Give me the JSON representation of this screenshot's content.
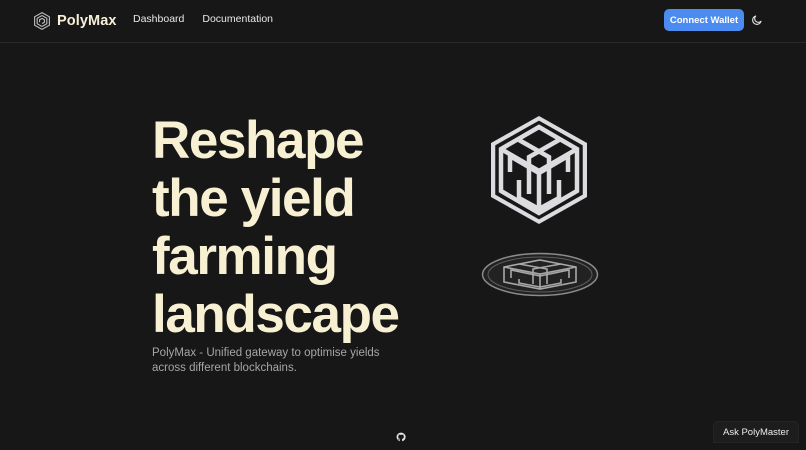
{
  "header": {
    "brand_name": "PolyMax",
    "nav": [
      {
        "label": "Dashboard"
      },
      {
        "label": "Documentation"
      }
    ],
    "connect_label": "Connect Wallet",
    "theme_icon": "moon-icon"
  },
  "hero": {
    "title_lines": [
      "Reshape",
      "the yield",
      "farming",
      "landscape"
    ],
    "subtitle": "PolyMax - Unified gateway to optimise yields across different blockchains."
  },
  "footer": {
    "github_icon": "github-icon",
    "ask_label": "Ask PolyMaster"
  },
  "colors": {
    "background": "#171717",
    "accent": "#4c8bf0",
    "title": "#f8f0d3",
    "subtitle": "#a6a6a6"
  }
}
